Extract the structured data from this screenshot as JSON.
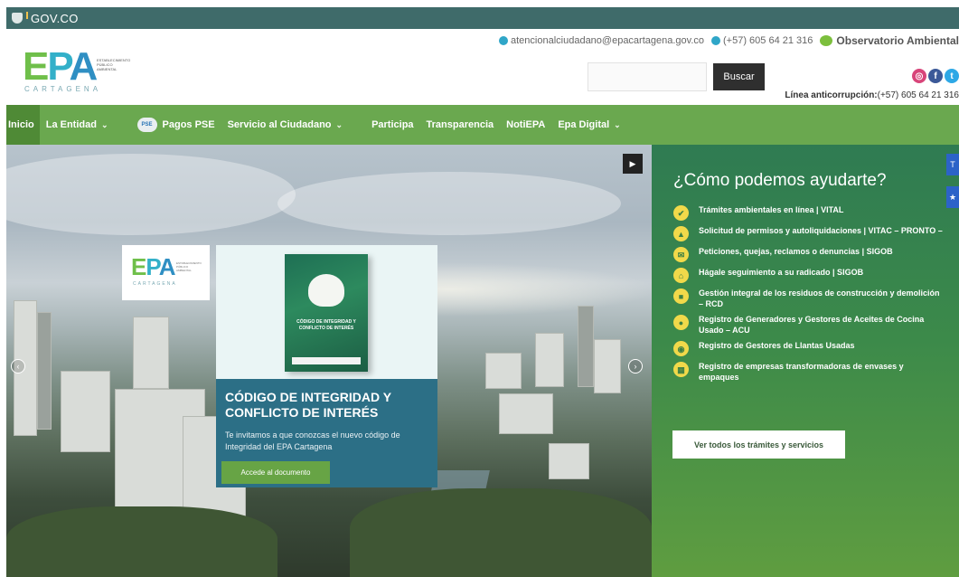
{
  "gov_bar": {
    "label": "GOV.CO"
  },
  "logo": {
    "letters": [
      "E",
      "P",
      "A"
    ],
    "side_text": "ESTABLECIMIENTO PÚBLICO AMBIENTAL",
    "city": "CARTAGENA"
  },
  "contact": {
    "email": "atencionalciudadano@epacartagena.gov.co",
    "phone": "(+57) 605 64 21 316",
    "observatorio": "Observatorio Ambiental"
  },
  "search": {
    "placeholder": "",
    "button_label": "Buscar"
  },
  "anticorruption": {
    "label": "Línea anticorrupción:",
    "phone": "(+57) 605 64 21 316"
  },
  "nav": {
    "items": [
      {
        "label": "Inicio"
      },
      {
        "label": "La Entidad"
      },
      {
        "label": "Pagos PSE"
      },
      {
        "label": "Servicio al Ciudadano"
      },
      {
        "label": "Participa"
      },
      {
        "label": "Transparencia"
      },
      {
        "label": "NotiEPA"
      },
      {
        "label": "Epa Digital"
      }
    ],
    "pse_badge": "PSE"
  },
  "promo": {
    "title": "CÓDIGO DE INTEGRIDAD Y CONFLICTO DE INTERÉS",
    "text": "Te invitamos a que conozcas el nuevo código de Integridad del EPA Cartagena",
    "button_label": "Accede al documento",
    "book_title": "CÓDIGO DE INTEGRIDAD Y CONFLICTO DE INTERÉS"
  },
  "help": {
    "title": "¿Cómo podemos ayudarte?",
    "items": [
      {
        "label": "Trámites ambientales en línea | VITAL",
        "icon": "check-icon"
      },
      {
        "label": "Solicitud de permisos y autoliquidaciones | VITAC – PRONTO –",
        "icon": "warning-icon"
      },
      {
        "label": "Peticiones, quejas, reclamos o denuncias | SIGOB",
        "icon": "mail-icon"
      },
      {
        "label": "Hágale seguimiento a su radicado | SIGOB",
        "icon": "tracking-icon"
      },
      {
        "label": "Gestión integral de los residuos de construcción y demolición – RCD",
        "icon": "truck-icon"
      },
      {
        "label": "Registro de Generadores y Gestores de Aceites de Cocina Usado – ACU",
        "icon": "oil-drop-icon"
      },
      {
        "label": "Registro de Gestores de Llantas Usadas",
        "icon": "tire-icon"
      },
      {
        "label": "Registro de empresas transformadoras de envases y empaques",
        "icon": "factory-icon"
      }
    ],
    "button_label": "Ver todos los trámites y servicios"
  },
  "colors": {
    "nav_green": "#6aa84f",
    "gov_bar": "#3f6b6a",
    "promo_panel": "#2c6f86",
    "help_panel": "#3c8a4a"
  }
}
